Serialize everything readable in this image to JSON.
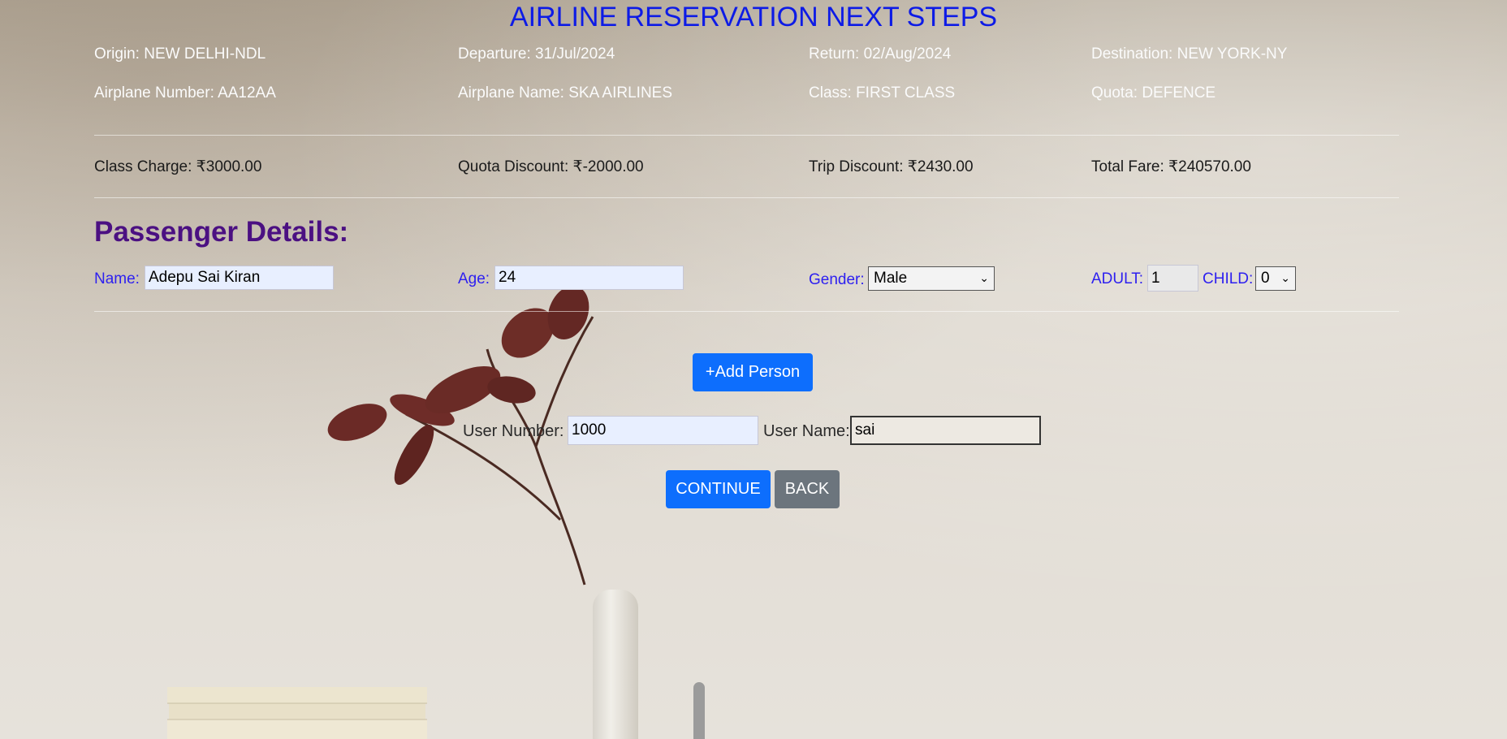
{
  "header": {
    "title": "AIRLINE RESERVATION NEXT STEPS"
  },
  "trip": {
    "origin": "Origin: NEW DELHI-NDL",
    "departure": "Departure: 31/Jul/2024",
    "return": "Return: 02/Aug/2024",
    "destination": "Destination: NEW YORK-NY",
    "airplane_number": "Airplane Number: AA12AA",
    "airplane_name": "Airplane Name: SKA AIRLINES",
    "class": "Class: FIRST CLASS",
    "quota": "Quota: DEFENCE"
  },
  "fare": {
    "class_charge": "Class Charge: ₹3000.00",
    "quota_discount": "Quota Discount: ₹-2000.00",
    "trip_discount": "Trip Discount: ₹2430.00",
    "total_fare": "Total Fare: ₹240570.00"
  },
  "passenger": {
    "section_title": "Passenger Details:",
    "name_label": "Name:",
    "name_value": "Adepu Sai Kiran",
    "age_label": "Age:",
    "age_value": "24",
    "gender_label": "Gender:",
    "gender_value": "Male",
    "adult_label": "ADULT:",
    "adult_value": "1",
    "child_label": "CHILD:",
    "child_value": "0"
  },
  "actions": {
    "add_person": "+Add Person",
    "user_number_label": "User Number:",
    "user_number_value": "1000",
    "user_name_label": "User Name:",
    "user_name_value": "sai",
    "continue": "CONTINUE",
    "back": "BACK"
  },
  "icons": {
    "select_arrow": "chevron-down-icon"
  },
  "colors": {
    "title": "#0d1be6",
    "section_title": "#4b1082",
    "form_label": "#2d1ff0",
    "primary": "#0d6efd",
    "secondary": "#6c757d"
  }
}
